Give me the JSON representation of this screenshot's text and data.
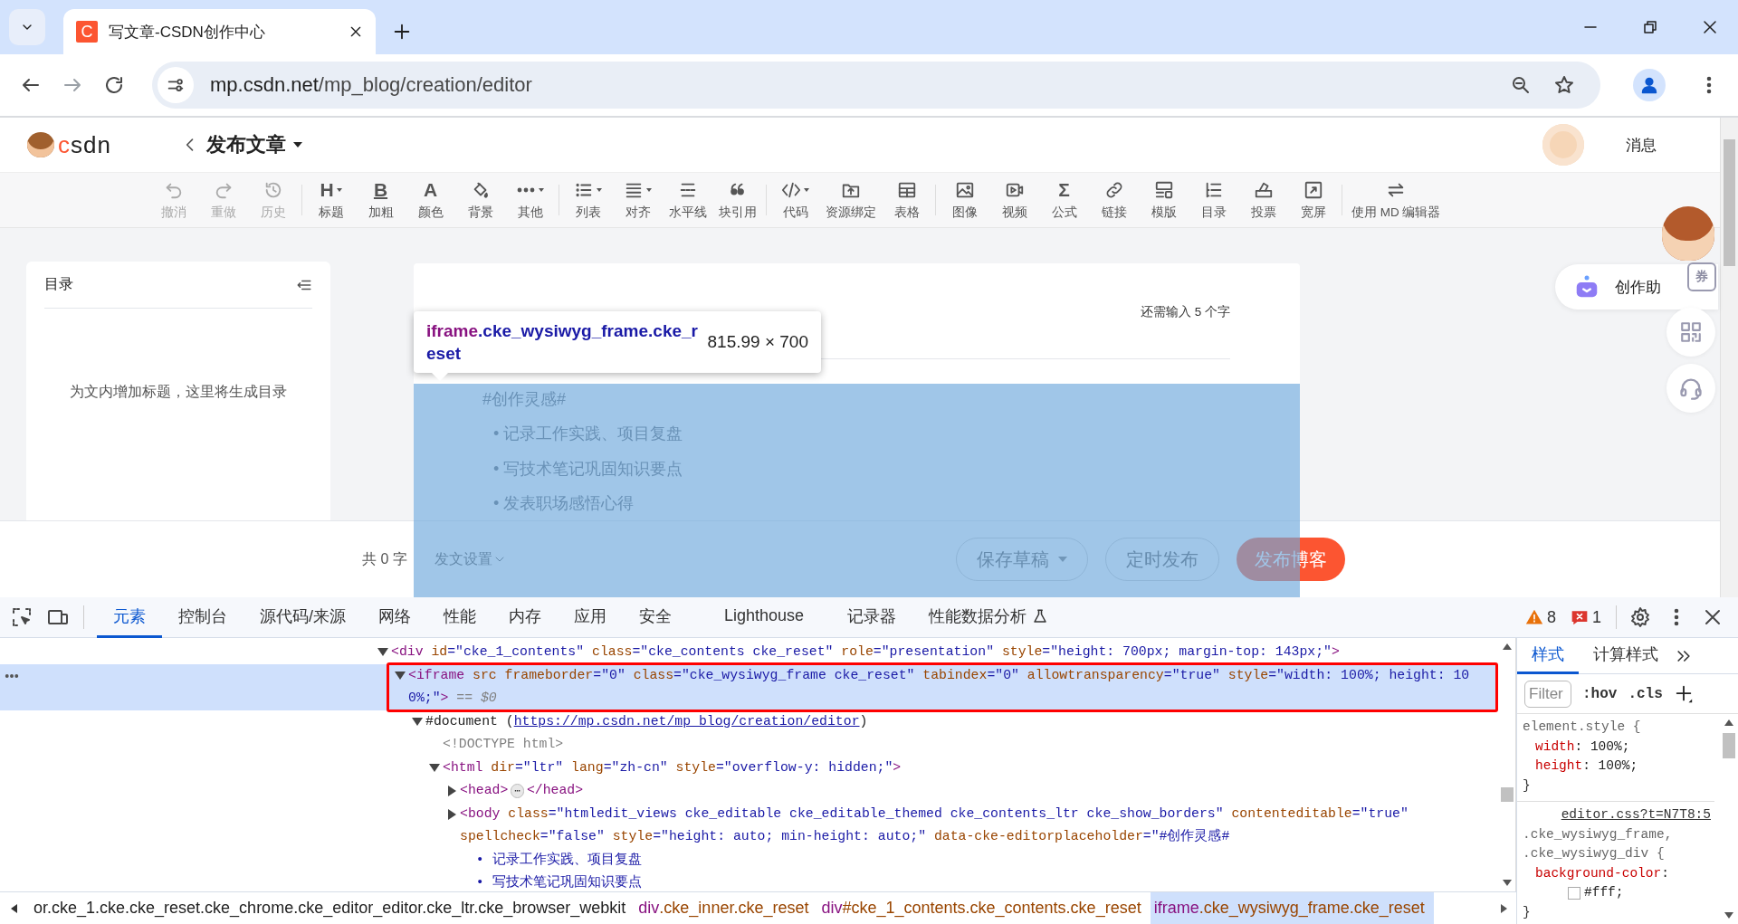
{
  "browser": {
    "tabs": [
      {
        "title": "写文章-CSDN创作中心",
        "favicon": "C",
        "selected": true
      }
    ],
    "nav": [
      {
        "disabled": false
      },
      {
        "disabled": true
      },
      {
        "disabled": false
      }
    ],
    "address": {
      "host": "mp.csdn.net",
      "path": "/mp_blog/creation/editor"
    }
  },
  "header": {
    "logo_text": "csdn",
    "title": "发布文章",
    "messages": "消息"
  },
  "toolbar": {
    "groups": [
      [
        {
          "label": "撤消",
          "disabled": true,
          "dropdown": false
        },
        {
          "label": "重做",
          "disabled": true,
          "dropdown": false
        },
        {
          "label": "历史",
          "disabled": true,
          "dropdown": false
        }
      ],
      [
        {
          "label": "标题",
          "glyph": "H",
          "disabled": false,
          "dropdown": true
        },
        {
          "label": "加粗",
          "glyph": "B",
          "disabled": false,
          "dropdown": false
        },
        {
          "label": "颜色",
          "glyph": "A",
          "disabled": false,
          "dropdown": false
        },
        {
          "label": "背景",
          "disabled": false,
          "dropdown": false
        },
        {
          "label": "其他",
          "disabled": false,
          "dropdown": true
        }
      ],
      [
        {
          "label": "列表",
          "disabled": false,
          "dropdown": true
        },
        {
          "label": "对齐",
          "disabled": false,
          "dropdown": true
        },
        {
          "label": "水平线",
          "disabled": false,
          "dropdown": false
        },
        {
          "label": "块引用",
          "disabled": false,
          "dropdown": false
        }
      ],
      [
        {
          "label": "代码",
          "disabled": false,
          "dropdown": true
        },
        {
          "label": "资源绑定",
          "disabled": false,
          "dropdown": false
        },
        {
          "label": "表格",
          "disabled": false,
          "dropdown": false
        }
      ],
      [
        {
          "label": "图像",
          "disabled": false,
          "dropdown": false
        },
        {
          "label": "视频",
          "disabled": false,
          "dropdown": false
        },
        {
          "label": "公式",
          "glyph": "Σ",
          "disabled": false,
          "dropdown": false
        },
        {
          "label": "链接",
          "disabled": false,
          "dropdown": false
        },
        {
          "label": "模版",
          "disabled": false,
          "dropdown": false
        },
        {
          "label": "目录",
          "disabled": false,
          "dropdown": false
        },
        {
          "label": "投票",
          "disabled": false,
          "dropdown": false
        },
        {
          "label": "宽屏",
          "disabled": false,
          "dropdown": false
        }
      ],
      [
        {
          "label": "使用 MD 编辑器",
          "disabled": false,
          "dropdown": false
        }
      ]
    ]
  },
  "toc": {
    "title": "目录",
    "empty_hint": "为文内增加标题，这里将生成目录"
  },
  "editor": {
    "counter": "还需输入 5 个字",
    "body_placeholder": "#创作灵感#",
    "bullets": [
      "• 记录工作实践、项目复盘",
      "• 写技术笔记巩固知识要点",
      "• 发表职场感悟心得"
    ]
  },
  "side_widgets": {
    "assistant": "创作助",
    "coupon": "券"
  },
  "footer": {
    "word_count": "共 0 字",
    "settings": "发文设置",
    "buttons": [
      {
        "label": "保存草稿",
        "kind": "outline",
        "dropdown": true
      },
      {
        "label": "定时发布",
        "kind": "outline",
        "dropdown": false
      },
      {
        "label": "发布博客",
        "kind": "primary",
        "dropdown": false
      }
    ]
  },
  "inspect_tooltip": {
    "tag": "iframe",
    "classes": ".cke_wysiwyg_frame.cke_reset",
    "size": "815.99 × 700"
  },
  "devtools": {
    "tabs": [
      {
        "label": "元素",
        "selected": true,
        "experimental": false
      },
      {
        "label": "控制台",
        "selected": false,
        "experimental": false
      },
      {
        "label": "源代码/来源",
        "selected": false,
        "experimental": false
      },
      {
        "label": "网络",
        "selected": false,
        "experimental": false
      },
      {
        "label": "性能",
        "selected": false,
        "experimental": false
      },
      {
        "label": "内存",
        "selected": false,
        "experimental": false
      },
      {
        "label": "应用",
        "selected": false,
        "experimental": false
      },
      {
        "label": "安全",
        "selected": false,
        "experimental": false
      },
      {
        "label": "Lighthouse",
        "selected": false,
        "experimental": false
      },
      {
        "label": "记录器",
        "selected": false,
        "experimental": false
      },
      {
        "label": "性能数据分析",
        "selected": false,
        "experimental": true
      }
    ],
    "warnings": "8",
    "errors": "1",
    "dom": [
      {
        "expanded": true,
        "selected": false,
        "annotated": false,
        "tokens": [
          {
            "kind": "tag",
            "text": "<div"
          },
          {
            "kind": "attr",
            "text": " id"
          },
          {
            "kind": "val",
            "text": "=\"cke_1_contents\""
          },
          {
            "kind": "attr",
            "text": " class"
          },
          {
            "kind": "val",
            "text": "=\"cke_contents cke_reset\""
          },
          {
            "kind": "attr",
            "text": " role"
          },
          {
            "kind": "val",
            "text": "=\"presentation\""
          },
          {
            "kind": "attr",
            "text": " style"
          },
          {
            "kind": "val",
            "text": "=\"height: 700px; margin-top: 143px;\""
          },
          {
            "kind": "tag",
            "text": ">"
          }
        ],
        "children": [
          {
            "expanded": true,
            "selected": true,
            "annotated": true,
            "tokens": [
              {
                "kind": "tag",
                "text": "<iframe"
              },
              {
                "kind": "attr",
                "text": " src frameborder"
              },
              {
                "kind": "val",
                "text": "=\"0\""
              },
              {
                "kind": "attr",
                "text": " class"
              },
              {
                "kind": "val",
                "text": "=\"cke_wysiwyg_frame cke_reset\""
              },
              {
                "kind": "attr",
                "text": " tabindex"
              },
              {
                "kind": "val",
                "text": "=\"0\""
              },
              {
                "kind": "attr",
                "text": " allowtransparency"
              },
              {
                "kind": "val",
                "text": "=\"true\""
              },
              {
                "kind": "attr",
                "text": " style"
              },
              {
                "kind": "val",
                "text": "=\"width: 100%; height: 10\n0%;\""
              },
              {
                "kind": "tag",
                "text": ">"
              },
              {
                "kind": "dim",
                "text": " == $0"
              }
            ],
            "children": [
              {
                "expanded": true,
                "selected": false,
                "annotated": false,
                "tokens": [
                  {
                    "kind": "txt",
                    "text": "#document ("
                  },
                  {
                    "kind": "link",
                    "text": "https://mp.csdn.net/mp_blog/creation/editor"
                  },
                  {
                    "kind": "txt",
                    "text": ")"
                  }
                ],
                "children": [
                  {
                    "selected": false,
                    "annotated": false,
                    "tokens": [
                      {
                        "kind": "doctype",
                        "text": "<!DOCTYPE html>"
                      }
                    ]
                  },
                  {
                    "expanded": true,
                    "selected": false,
                    "annotated": false,
                    "tokens": [
                      {
                        "kind": "tag",
                        "text": "<html"
                      },
                      {
                        "kind": "attr",
                        "text": " dir"
                      },
                      {
                        "kind": "val",
                        "text": "=\"ltr\""
                      },
                      {
                        "kind": "attr",
                        "text": " lang"
                      },
                      {
                        "kind": "val",
                        "text": "=\"zh-cn\""
                      },
                      {
                        "kind": "attr",
                        "text": " style"
                      },
                      {
                        "kind": "val",
                        "text": "=\"overflow-y: hidden;\""
                      },
                      {
                        "kind": "tag",
                        "text": ">"
                      }
                    ],
                    "children": [
                      {
                        "expanded": false,
                        "selected": false,
                        "annotated": false,
                        "tokens": [
                          {
                            "kind": "tag",
                            "text": "<head>"
                          },
                          {
                            "kind": "more",
                            "text": "⋯"
                          },
                          {
                            "kind": "tag",
                            "text": "</head>"
                          }
                        ]
                      },
                      {
                        "expanded": false,
                        "selected": false,
                        "annotated": false,
                        "tokens": [
                          {
                            "kind": "tag",
                            "text": "<body"
                          },
                          {
                            "kind": "attr",
                            "text": " class"
                          },
                          {
                            "kind": "val",
                            "text": "=\"htmledit_views cke_editable cke_editable_themed cke_contents_ltr cke_show_borders\""
                          },
                          {
                            "kind": "attr",
                            "text": " contenteditable"
                          },
                          {
                            "kind": "val",
                            "text": "=\"true\""
                          },
                          {
                            "kind": "attr",
                            "text": "\nspellcheck"
                          },
                          {
                            "kind": "val",
                            "text": "=\"false\""
                          },
                          {
                            "kind": "attr",
                            "text": " style"
                          },
                          {
                            "kind": "val",
                            "text": "=\"height: auto; min-height: auto;\""
                          },
                          {
                            "kind": "attr",
                            "text": " data-cke-editorplaceholder"
                          },
                          {
                            "kind": "val",
                            "text": "=\"#创作灵感#\n  • 记录工作实践、项目复盘\n  • 写技术笔记巩固知识要点"
                          }
                        ]
                      }
                    ]
                  }
                ]
              }
            ]
          }
        ]
      }
    ],
    "breadcrumbs": [
      {
        "selected": false,
        "tokens": [
          {
            "kind": "txt",
            "text": "or.cke_1.cke.cke_reset.cke_chrome.cke_editor_editor.cke_ltr.cke_browser_webkit"
          }
        ]
      },
      {
        "selected": false,
        "tokens": [
          {
            "kind": "tag",
            "text": "div"
          },
          {
            "kind": "cls",
            "text": ".cke_inner.cke_reset"
          }
        ]
      },
      {
        "selected": false,
        "tokens": [
          {
            "kind": "tag",
            "text": "div"
          },
          {
            "kind": "cls",
            "text": "#cke_1_contents.cke_contents.cke_reset"
          }
        ]
      },
      {
        "selected": true,
        "tokens": [
          {
            "kind": "tag",
            "text": "iframe"
          },
          {
            "kind": "cls",
            "text": ".cke_wysiwyg_frame.cke_reset"
          }
        ]
      }
    ],
    "styles": {
      "tabs": [
        {
          "label": "样式",
          "selected": true
        },
        {
          "label": "计算样式",
          "selected": false
        }
      ],
      "filter_placeholder": "Filter",
      "toggles": [
        ":hov",
        ".cls"
      ],
      "rules": [
        {
          "selector_lines": [
            "element.style {"
          ],
          "declarations": [
            {
              "tokens": [
                {
                  "kind": "prop",
                  "text": "width"
                },
                {
                  "kind": "txt",
                  "text": ": 100%;"
                }
              ]
            },
            {
              "tokens": [
                {
                  "kind": "prop",
                  "text": "height"
                },
                {
                  "kind": "txt",
                  "text": ": 100%;"
                }
              ]
            }
          ],
          "close": "}"
        },
        {
          "source": "editor.css?t=N7T8:5",
          "selector_lines": [
            ".cke_wysiwyg_frame,",
            ".cke_wysiwyg_div {"
          ],
          "declarations": [
            {
              "tokens": [
                {
                  "kind": "prop",
                  "text": "background-color"
                },
                {
                  "kind": "txt",
                  "text": ":"
                }
              ]
            },
            {
              "color": "#ffffff",
              "tokens": [
                {
                  "kind": "txt",
                  "text": "#fff;"
                }
              ]
            }
          ],
          "close": "}"
        }
      ]
    }
  }
}
